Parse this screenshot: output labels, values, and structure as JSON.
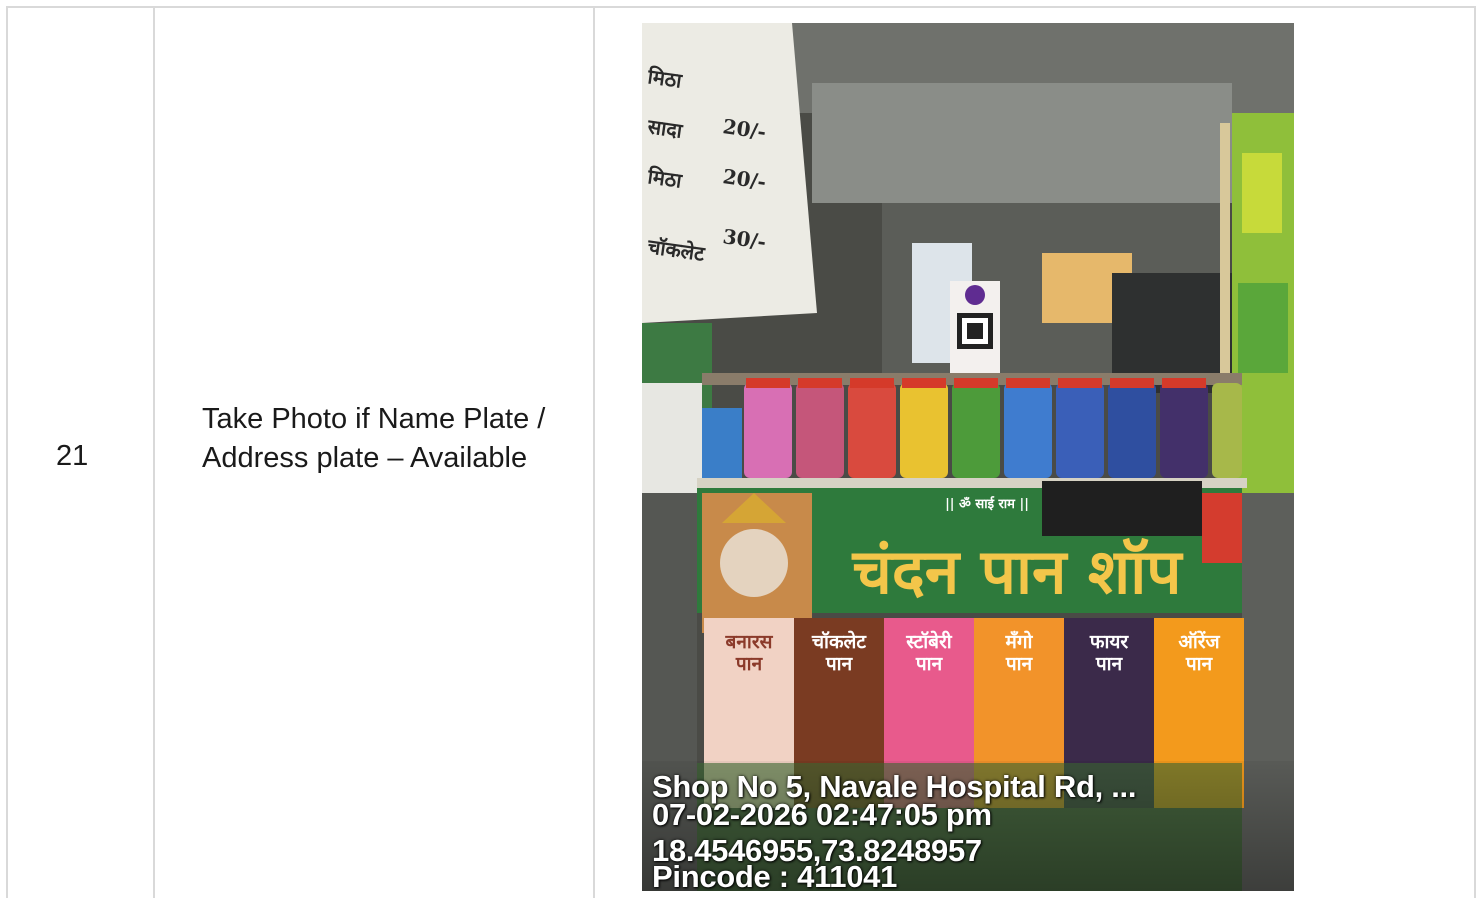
{
  "row": {
    "number": "21",
    "description": "Take Photo if Name Plate / Address plate – Available"
  },
  "photo": {
    "alt": "Shop front photo",
    "shop_sign": "चंदन पान शॉप",
    "sign_tagline": "|| ॐ साई राम ||",
    "flavors": [
      {
        "name": "बनारस पान",
        "color": "#f1d2c4"
      },
      {
        "name": "चॉकलेट पान",
        "color": "#7a3b22"
      },
      {
        "name": "स्टॉबेरी पान",
        "color": "#e85a8c"
      },
      {
        "name": "मँगो पान",
        "color": "#f2932a"
      },
      {
        "name": "फायर पान",
        "color": "#3b2a4a"
      },
      {
        "name": "ऑरेंज पान",
        "color": "#f39a1c"
      }
    ],
    "stamp": {
      "address": "Shop No 5, Navale Hospital Rd, ...",
      "datetime": "07-02-2026 02:47:05 pm",
      "coordinates": "18.4546955,73.8248957",
      "pincode": "Pincode : 411041"
    }
  }
}
